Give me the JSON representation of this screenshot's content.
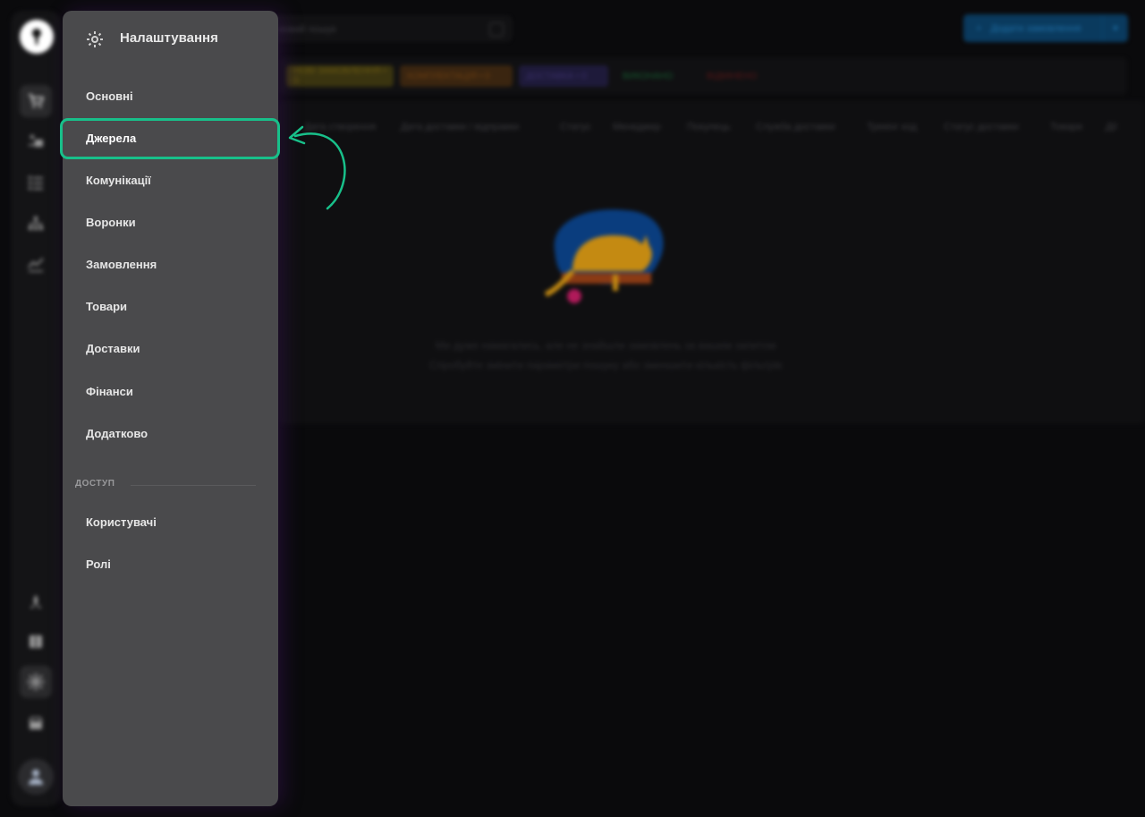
{
  "search": {
    "placeholder": "иовий пошук"
  },
  "create_button": {
    "label": "Додати замовлення"
  },
  "status_filters": [
    {
      "label": "НОВІ ЗАМОВЛЕННЯ • 0",
      "color": "#6b5a10"
    },
    {
      "label": "КОМПЛЕКТАЦІЯ • 0",
      "color": "#6e3f12"
    },
    {
      "label": "ДОСТАВКА • 0",
      "color": "#3a2f6a"
    },
    {
      "label": "ВИКОНАНО",
      "color": "#145a2e"
    },
    {
      "label": "ВІДМІНЕНО",
      "color": "#5a1616"
    }
  ],
  "table_headers": [
    "Дата створення",
    "Дата доставки / відправки",
    "Статус",
    "Менеджер",
    "Покупець",
    "Служба доставки",
    "Трекінг код",
    "Статус доставки",
    "Товари",
    "Дії"
  ],
  "empty_state": {
    "line1": "Ми дуже намагались, але не знайшли замовлень за вашим запитом",
    "line2": "Спробуйте змінити параметри пошуку або зменшити кількість фільтрів"
  },
  "settings_panel": {
    "title": "Налаштування",
    "items": [
      "Основні",
      "Джерела",
      "Комунікації",
      "Воронки",
      "Замовлення",
      "Товари",
      "Доставки",
      "Фінанси",
      "Додатково"
    ],
    "section_label": "ДОСТУП",
    "access_items": [
      "Користувачі",
      "Ролі"
    ]
  },
  "colors": {
    "highlight": "#18c08a",
    "panel_bg": "#4a4a4c",
    "accent_blue": "#0a3a5e"
  }
}
